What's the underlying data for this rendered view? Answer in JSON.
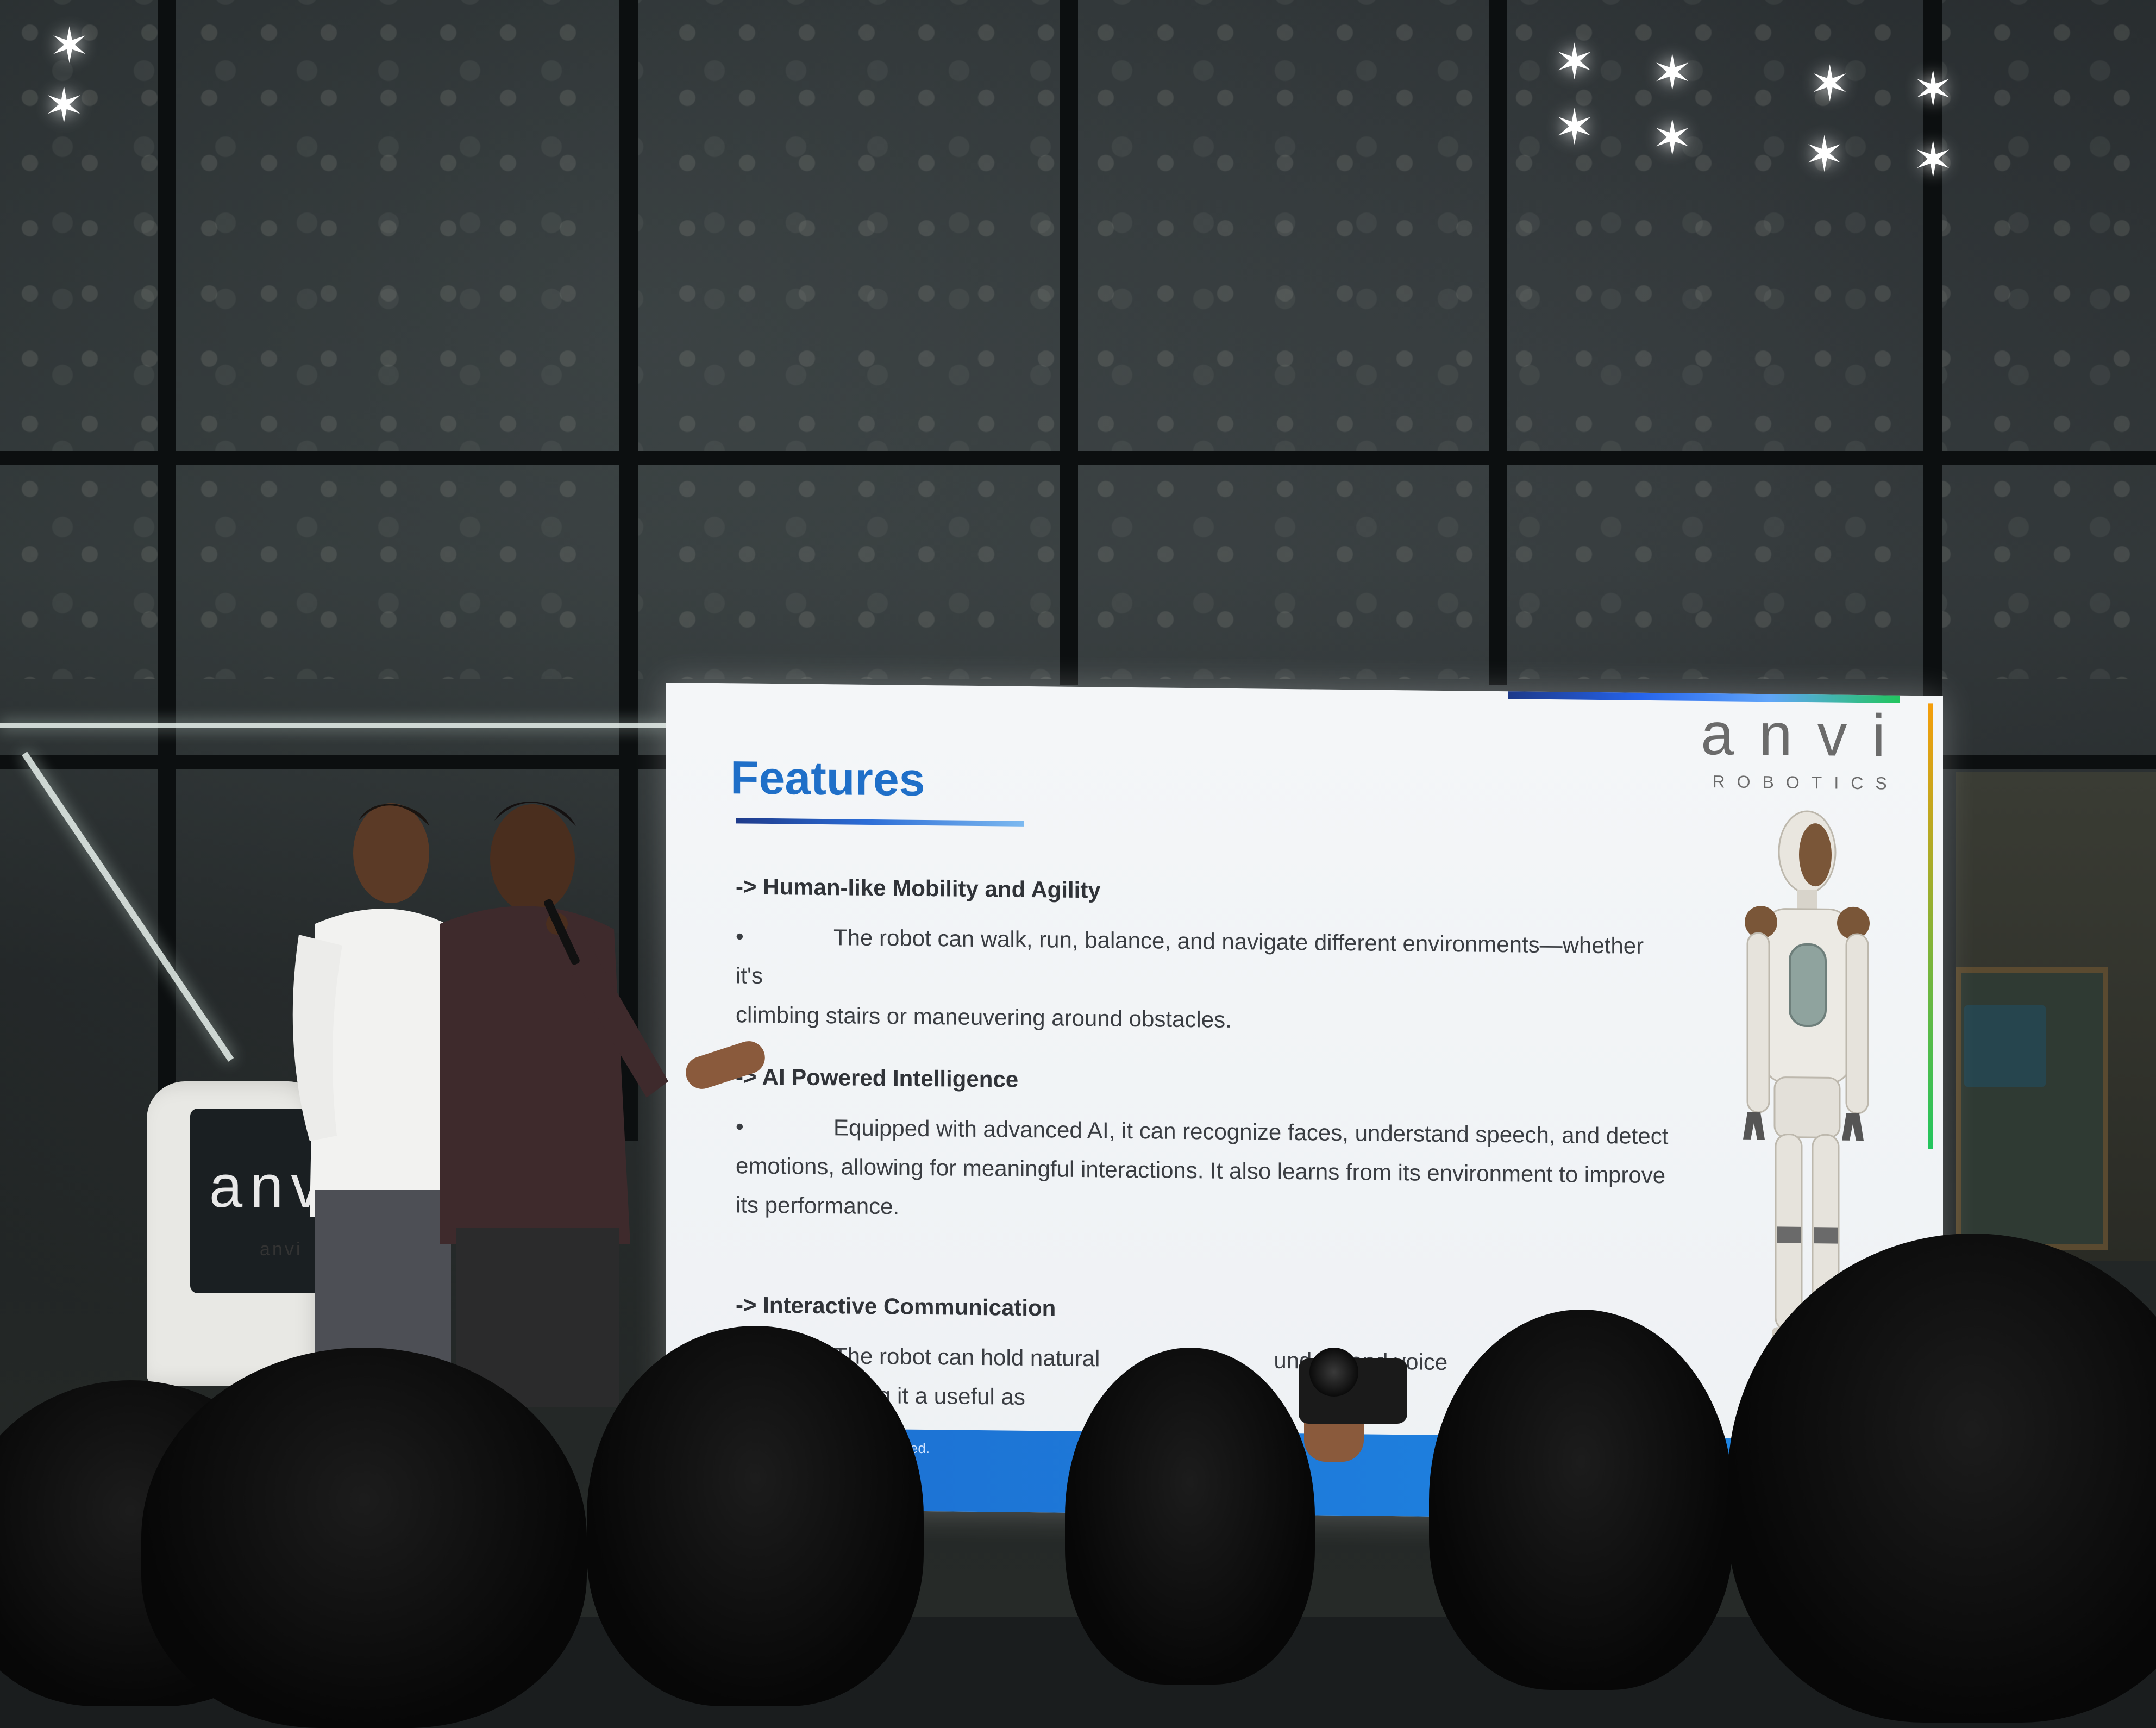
{
  "slide": {
    "title": "Features",
    "brand": {
      "name": "anvi",
      "subtitle": "ROBOTICS"
    },
    "sections": [
      {
        "heading": "-> Human-like Mobility and Agility",
        "bullet_marker": "•",
        "text_line1": "The robot can walk, run, balance, and navigate different environments—whether it's",
        "text_line2": "climbing stairs or maneuvering around obstacles."
      },
      {
        "heading": "-> AI Powered Intelligence",
        "bullet_marker": "•",
        "text_line1": "Equipped with advanced AI, it can recognize faces, understand speech, and detect",
        "text_line2": "emotions, allowing for meaningful interactions. It also learns from its environment to improve",
        "text_line3": "its performance."
      },
      {
        "heading": "-> Interactive Communication",
        "bullet_marker": "•",
        "text_line1": "The robot can hold natural",
        "text_line1b": "understand voice",
        "text_line1c": "nd",
        "text_line2": "making it a useful as"
      }
    ],
    "footer_fragment": "gned."
  },
  "kiosk": {
    "logo": "anvi",
    "label": "anvi"
  },
  "colors": {
    "title_blue": "#1f6fc8",
    "footer_blue": "#1e88e5",
    "body_text": "#3a3d42"
  }
}
